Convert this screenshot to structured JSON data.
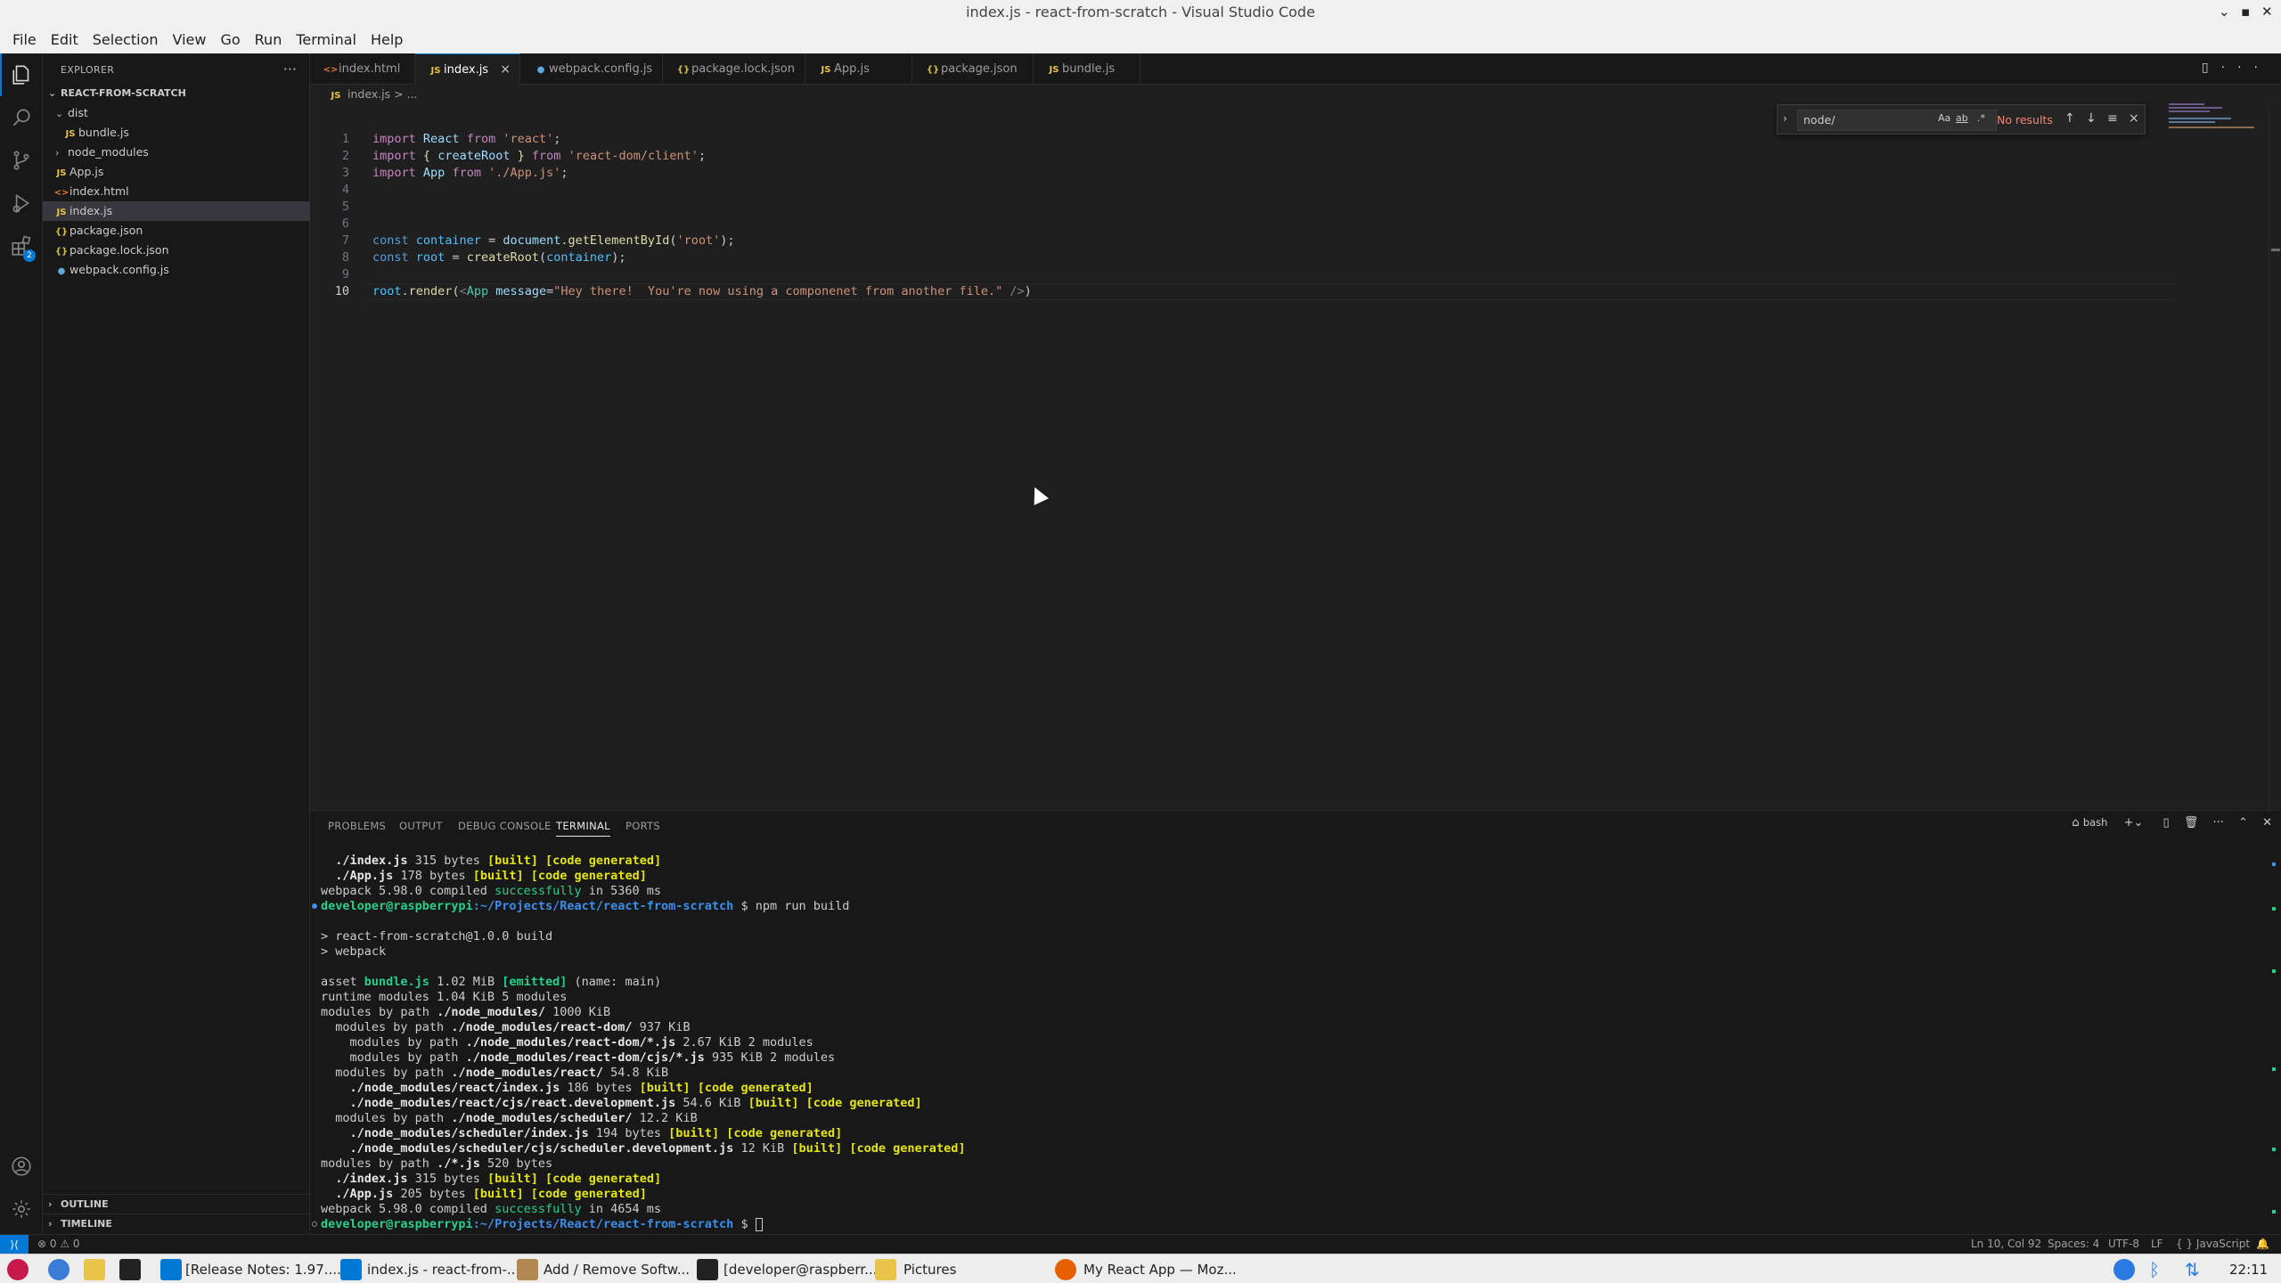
{
  "window": {
    "title": "index.js - react-from-scratch - Visual Studio Code"
  },
  "menu": [
    "File",
    "Edit",
    "Selection",
    "View",
    "Go",
    "Run",
    "Terminal",
    "Help"
  ],
  "explorer": {
    "header": "EXPLORER",
    "project": "REACT-FROM-SCRATCH",
    "items": [
      {
        "label": "dist",
        "type": "folder-open",
        "icon": ""
      },
      {
        "label": "bundle.js",
        "type": "js",
        "icon": "JS"
      },
      {
        "label": "node_modules",
        "type": "folder",
        "icon": ""
      },
      {
        "label": "App.js",
        "type": "js",
        "icon": "JS"
      },
      {
        "label": "index.html",
        "type": "html",
        "icon": "<>"
      },
      {
        "label": "index.js",
        "type": "js",
        "icon": "JS"
      },
      {
        "label": "package.json",
        "type": "json",
        "icon": "{}"
      },
      {
        "label": "package.lock.json",
        "type": "json",
        "icon": "{}"
      },
      {
        "label": "webpack.config.js",
        "type": "wp",
        "icon": "●"
      }
    ],
    "outline": "OUTLINE",
    "timeline": "TIMELINE"
  },
  "tabs": [
    {
      "label": "index.html",
      "icon": "<>"
    },
    {
      "label": "index.js",
      "icon": "JS",
      "close": "×"
    },
    {
      "label": "webpack.config.js",
      "icon": "●"
    },
    {
      "label": "package.lock.json",
      "icon": "{}"
    },
    {
      "label": "App.js",
      "icon": "JS"
    },
    {
      "label": "package.json",
      "icon": "{}"
    },
    {
      "label": "bundle.js",
      "icon": "JS"
    }
  ],
  "breadcrumb": {
    "icon": "JS",
    "file": "index.js",
    "sep": ">",
    "rest": "..."
  },
  "editor": {
    "line_numbers": [
      "1",
      "2",
      "3",
      "4",
      "5",
      "6",
      "7",
      "8",
      "9",
      "10"
    ],
    "current_line": 10,
    "lines": {
      "l1": [
        "import",
        "React",
        "from",
        "'react'",
        ";"
      ],
      "l2": [
        "import",
        "{",
        "createRoot",
        "}",
        "from",
        "'react-dom/client'",
        ";"
      ],
      "l3": [
        "import",
        "App",
        "from",
        "'./App.js'",
        ";"
      ],
      "l7": [
        "const",
        "container",
        "=",
        "document",
        ".",
        "getElementById",
        "(",
        "'root'",
        ");"
      ],
      "l8": [
        "const",
        "root",
        "=",
        "createRoot",
        "(",
        "container",
        ");"
      ],
      "l10": [
        "root",
        ".",
        "render",
        "(",
        "<",
        "App",
        "message",
        "=",
        "\"Hey there!  You're now using a componenet from another file.\"",
        "/>",
        ")"
      ]
    }
  },
  "find": {
    "value": "node/",
    "case": "Aa",
    "word": "ab",
    "regex": ".*",
    "result": "No results",
    "up": "↑",
    "down": "↓",
    "menu": "≡",
    "close": "×"
  },
  "panel": {
    "tabs": [
      "PROBLEMS",
      "OUTPUT",
      "DEBUG CONSOLE",
      "TERMINAL",
      "PORTS"
    ],
    "shell": "bash",
    "terminal": {
      "t1": [
        "./index.js",
        "315 bytes",
        "[built]",
        "[code generated]"
      ],
      "t2": [
        "./App.js",
        "178 bytes",
        "[built]",
        "[code generated]"
      ],
      "t3": [
        "webpack 5.98.0 compiled",
        "successfully",
        "in 5360 ms"
      ],
      "prompt1": [
        "developer@raspberrypi",
        ":~/Projects/React/react-from-scratch",
        "$",
        "npm run build"
      ],
      "t5": "> react-from-scratch@1.0.0 build",
      "t6": "> webpack",
      "t8": [
        "asset",
        "bundle.js",
        "1.02 MiB",
        "[emitted]",
        "(name: main)"
      ],
      "t9": "runtime modules 1.04 KiB 5 modules",
      "t10": [
        "modules by path",
        "./node_modules/",
        "1000 KiB"
      ],
      "t11": [
        "modules by path",
        "./node_modules/react-dom/",
        "937 KiB"
      ],
      "t12": [
        "modules by path",
        "./node_modules/react-dom/*.js",
        "2.67 KiB 2 modules"
      ],
      "t13": [
        "modules by path",
        "./node_modules/react-dom/cjs/*.js",
        "935 KiB 2 modules"
      ],
      "t14": [
        "modules by path",
        "./node_modules/react/",
        "54.8 KiB"
      ],
      "t15": [
        "./node_modules/react/index.js",
        "186 bytes",
        "[built]",
        "[code generated]"
      ],
      "t16": [
        "./node_modules/react/cjs/react.development.js",
        "54.6 KiB",
        "[built]",
        "[code generated]"
      ],
      "t17": [
        "modules by path",
        "./node_modules/scheduler/",
        "12.2 KiB"
      ],
      "t18": [
        "./node_modules/scheduler/index.js",
        "194 bytes",
        "[built]",
        "[code generated]"
      ],
      "t19": [
        "./node_modules/scheduler/cjs/scheduler.development.js",
        "12 KiB",
        "[built]",
        "[code generated]"
      ],
      "t20": [
        "modules by path",
        "./*.js",
        "520 bytes"
      ],
      "t21": [
        "./index.js",
        "315 bytes",
        "[built]",
        "[code generated]"
      ],
      "t22": [
        "./App.js",
        "205 bytes",
        "[built]",
        "[code generated]"
      ],
      "t23": [
        "webpack 5.98.0 compiled",
        "successfully",
        "in 4654 ms"
      ],
      "prompt2": [
        "developer@raspberrypi",
        ":~/Projects/React/react-from-scratch",
        "$"
      ]
    }
  },
  "status": {
    "errors": "0",
    "warnings": "0",
    "position": "Ln 10, Col 92",
    "spaces": "Spaces: 4",
    "encoding": "UTF-8",
    "eol": "LF",
    "language": "JavaScript",
    "lang_icon": "{ }"
  },
  "taskbar": {
    "items": [
      "[Release Notes: 1.97....",
      "index.js - react-from-...",
      "Add / Remove Softw...",
      "[developer@raspberr...",
      "Pictures",
      "My React App — Moz..."
    ],
    "clock": "22:11"
  },
  "colors": {
    "accent": "#0078d4",
    "bg": "#1f1f1f",
    "sidebar": "#181818"
  }
}
